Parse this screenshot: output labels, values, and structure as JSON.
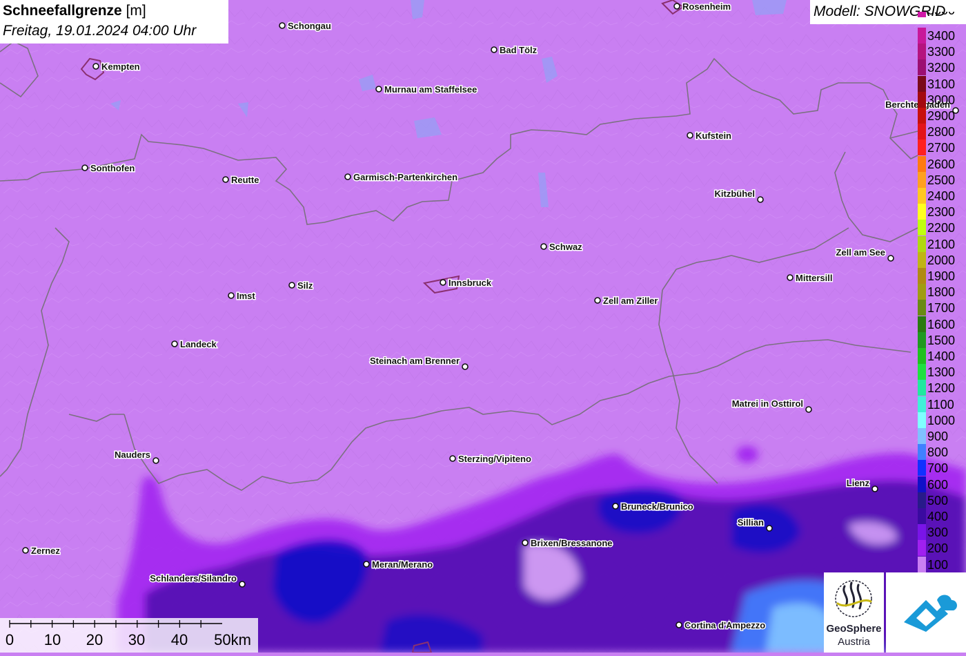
{
  "header": {
    "title_bold": "Schneefallgrenze",
    "title_unit": "[m]",
    "datetime": "Freitag, 19.01.2024 04:00 Uhr"
  },
  "model_label": "Modell: SNOWGRID",
  "legend": {
    "top_label": "3500",
    "items": [
      {
        "label": "3400",
        "color": "#c8189a"
      },
      {
        "label": "3300",
        "color": "#b5137f"
      },
      {
        "label": "3200",
        "color": "#9c0f72"
      },
      {
        "label": "3100",
        "color": "#7a0a1a"
      },
      {
        "label": "3000",
        "color": "#a30a10"
      },
      {
        "label": "2900",
        "color": "#c8100c"
      },
      {
        "label": "2800",
        "color": "#e3141a"
      },
      {
        "label": "2700",
        "color": "#ff2020"
      },
      {
        "label": "2600",
        "color": "#ff7a10"
      },
      {
        "label": "2500",
        "color": "#ffa020"
      },
      {
        "label": "2400",
        "color": "#ffc820"
      },
      {
        "label": "2300",
        "color": "#ffff20"
      },
      {
        "label": "2200",
        "color": "#c0ff10"
      },
      {
        "label": "2100",
        "color": "#b0d810"
      },
      {
        "label": "2000",
        "color": "#c0b414"
      },
      {
        "label": "1900",
        "color": "#b08a14"
      },
      {
        "label": "1800",
        "color": "#a09c14"
      },
      {
        "label": "1700",
        "color": "#6a8a14"
      },
      {
        "label": "1600",
        "color": "#2a7a10"
      },
      {
        "label": "1500",
        "color": "#209820"
      },
      {
        "label": "1400",
        "color": "#20c020"
      },
      {
        "label": "1300",
        "color": "#20e040"
      },
      {
        "label": "1200",
        "color": "#20e8a0"
      },
      {
        "label": "1100",
        "color": "#40f0d8"
      },
      {
        "label": "1000",
        "color": "#80ffff"
      },
      {
        "label": "900",
        "color": "#80c0ff"
      },
      {
        "label": "800",
        "color": "#4080ff"
      },
      {
        "label": "700",
        "color": "#1030ff"
      },
      {
        "label": "600",
        "color": "#1010c8"
      },
      {
        "label": "500",
        "color": "#281a8a"
      },
      {
        "label": "400",
        "color": "#3a0aa0"
      },
      {
        "label": "300",
        "color": "#7a14e8"
      },
      {
        "label": "200",
        "color": "#a020f0"
      },
      {
        "label": "100",
        "color": "#c97ff2"
      }
    ]
  },
  "map": {
    "background_color": "#c97ff2",
    "cities": [
      {
        "name": "Rosenheim",
        "anchor": "right"
      },
      {
        "name": "Schongau",
        "anchor": "right"
      },
      {
        "name": "Bad Tölz",
        "anchor": "right"
      },
      {
        "name": "Kempten",
        "anchor": "right"
      },
      {
        "name": "Murnau am Staffelsee",
        "anchor": "right"
      },
      {
        "name": "Berchtesgaden",
        "anchor": "left"
      },
      {
        "name": "Kufstein",
        "anchor": "right"
      },
      {
        "name": "Sonthofen",
        "anchor": "right"
      },
      {
        "name": "Reutte",
        "anchor": "right"
      },
      {
        "name": "Garmisch-Partenkirchen",
        "anchor": "right"
      },
      {
        "name": "Kitzbühel",
        "anchor": "left"
      },
      {
        "name": "Schwaz",
        "anchor": "right"
      },
      {
        "name": "Zell am See",
        "anchor": "left"
      },
      {
        "name": "Mittersill",
        "anchor": "right"
      },
      {
        "name": "Silz",
        "anchor": "right"
      },
      {
        "name": "Innsbruck",
        "anchor": "right"
      },
      {
        "name": "Imst",
        "anchor": "right"
      },
      {
        "name": "Zell am Ziller",
        "anchor": "right"
      },
      {
        "name": "Landeck",
        "anchor": "right"
      },
      {
        "name": "Steinach am Brenner",
        "anchor": "left"
      },
      {
        "name": "Matrei in Osttirol",
        "anchor": "left"
      },
      {
        "name": "Nauders",
        "anchor": "left"
      },
      {
        "name": "Sterzing/Vipiteno",
        "anchor": "right"
      },
      {
        "name": "Lienz",
        "anchor": "left"
      },
      {
        "name": "Bruneck/Brunico",
        "anchor": "right"
      },
      {
        "name": "Sillian",
        "anchor": "left"
      },
      {
        "name": "Brixen/Bressanone",
        "anchor": "right"
      },
      {
        "name": "Zernez",
        "anchor": "right"
      },
      {
        "name": "Meran/Merano",
        "anchor": "right"
      },
      {
        "name": "Schlanders/Silandro",
        "anchor": "left"
      },
      {
        "name": "Cortina d'Ampezzo",
        "anchor": "right"
      }
    ]
  },
  "scale_bar": {
    "labels": [
      "0",
      "10",
      "20",
      "30",
      "40",
      "50km"
    ]
  },
  "logos": {
    "geosphere_line1": "GeoSphere",
    "geosphere_line2": "Austria"
  }
}
